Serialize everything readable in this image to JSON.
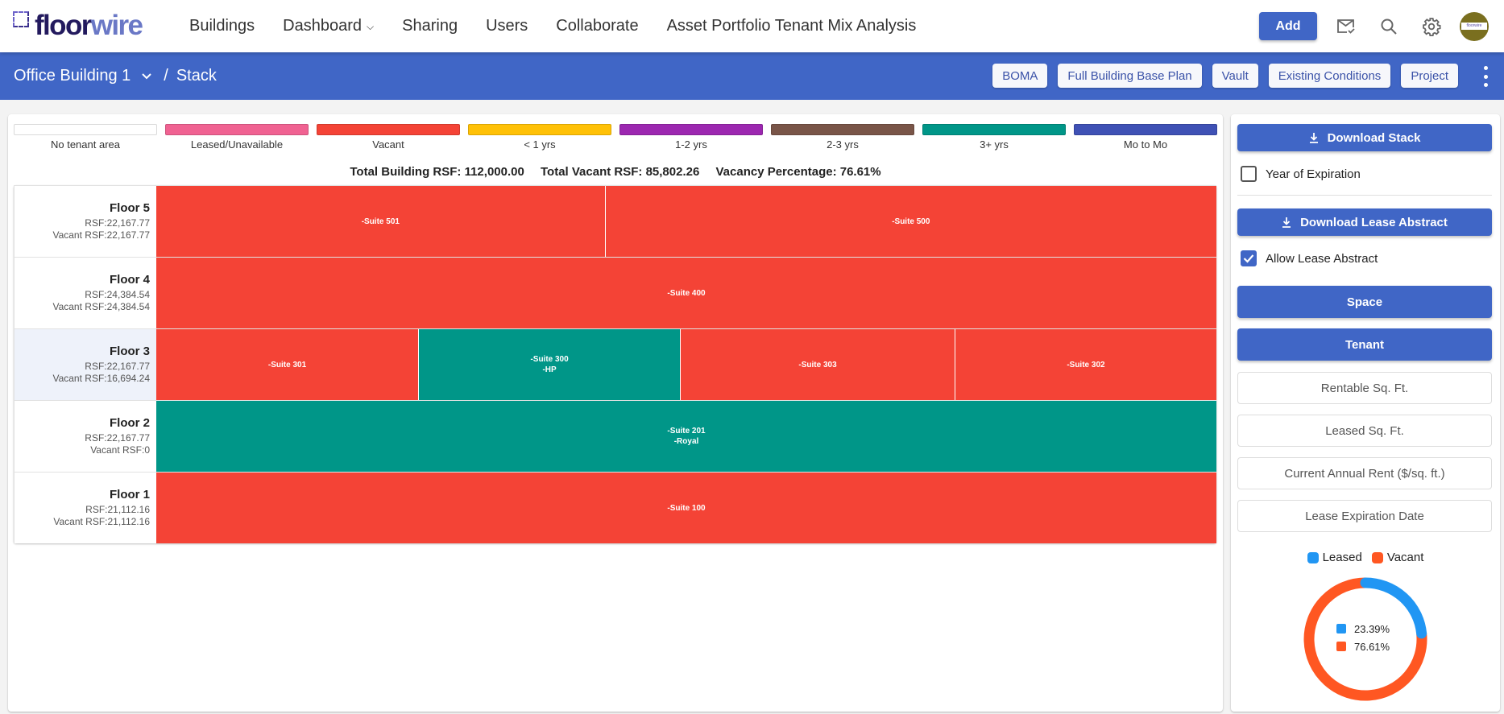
{
  "topnav": {
    "logo": {
      "part1": "floor",
      "part2": "wire"
    },
    "items": [
      {
        "label": "Buildings"
      },
      {
        "label": "Dashboard",
        "has_dropdown": true
      },
      {
        "label": "Sharing"
      },
      {
        "label": "Users"
      },
      {
        "label": "Collaborate"
      },
      {
        "label": "Asset Portfolio Tenant Mix Analysis"
      }
    ],
    "add_label": "Add",
    "icons": [
      "mail-check-icon",
      "search-icon",
      "gear-icon"
    ],
    "avatar_text": "floorwire"
  },
  "subheader": {
    "building": "Office Building 1",
    "separator": "/",
    "page": "Stack",
    "buttons": [
      {
        "label": "BOMA"
      },
      {
        "label": "Full Building Base Plan"
      },
      {
        "label": "Vault"
      },
      {
        "label": "Existing Conditions"
      },
      {
        "label": "Project"
      }
    ]
  },
  "colors": {
    "primary": "#4066c6",
    "vacant": "#f44336",
    "three_plus": "#009688",
    "donut_leased": "#2196f3",
    "donut_vacant": "#ff5722"
  },
  "legend": [
    {
      "label": "No tenant area",
      "color": "#ffffff"
    },
    {
      "label": "Leased/Unavailable",
      "color": "#f06292"
    },
    {
      "label": "Vacant",
      "color": "#f44336"
    },
    {
      "label": "< 1 yrs",
      "color": "#ffc107"
    },
    {
      "label": "1-2 yrs",
      "color": "#9c27b0"
    },
    {
      "label": "2-3 yrs",
      "color": "#795548"
    },
    {
      "label": "3+ yrs",
      "color": "#009688"
    },
    {
      "label": "Mo to Mo",
      "color": "#3f51b5"
    }
  ],
  "totals": {
    "total_building": "Total Building RSF: 112,000.00",
    "total_vacant": "Total Vacant RSF: 85,802.26",
    "vacancy": "Vacancy Percentage: 76.61%"
  },
  "floors": [
    {
      "name": "Floor 5",
      "rsf": "RSF:22,167.77",
      "vacant": "Vacant RSF:22,167.77",
      "highlight": false,
      "suites": [
        {
          "lines": [
            "-Suite 501"
          ],
          "status": "Vacant",
          "share": 0.423
        },
        {
          "lines": [
            "-Suite 500"
          ],
          "status": "Vacant",
          "share": 0.577
        }
      ]
    },
    {
      "name": "Floor 4",
      "rsf": "RSF:24,384.54",
      "vacant": "Vacant RSF:24,384.54",
      "highlight": false,
      "suites": [
        {
          "lines": [
            "-Suite 400"
          ],
          "status": "Vacant",
          "share": 1.0
        }
      ]
    },
    {
      "name": "Floor 3",
      "rsf": "RSF:22,167.77",
      "vacant": "Vacant RSF:16,694.24",
      "highlight": true,
      "suites": [
        {
          "lines": [
            "-Suite 301"
          ],
          "status": "Vacant",
          "share": 0.247
        },
        {
          "lines": [
            "-Suite 300",
            "-HP"
          ],
          "status": "3+ yrs",
          "share": 0.247
        },
        {
          "lines": [
            "-Suite 303"
          ],
          "status": "Vacant",
          "share": 0.259
        },
        {
          "lines": [
            "-Suite 302"
          ],
          "status": "Vacant",
          "share": 0.247
        }
      ]
    },
    {
      "name": "Floor 2",
      "rsf": "RSF:22,167.77",
      "vacant": "Vacant RSF:0",
      "highlight": false,
      "suites": [
        {
          "lines": [
            "-Suite 201",
            "-Royal"
          ],
          "status": "3+ yrs",
          "share": 1.0
        }
      ]
    },
    {
      "name": "Floor 1",
      "rsf": "RSF:21,112.16",
      "vacant": "Vacant RSF:21,112.16",
      "highlight": false,
      "suites": [
        {
          "lines": [
            "-Suite 100"
          ],
          "status": "Vacant",
          "share": 1.0
        }
      ]
    }
  ],
  "side": {
    "download_stack": "Download Stack",
    "year_of_expiration": {
      "label": "Year of Expiration",
      "checked": false
    },
    "download_lease_abstract": "Download Lease Abstract",
    "allow_lease_abstract": {
      "label": "Allow Lease Abstract",
      "checked": true
    },
    "space": "Space",
    "tenant": "Tenant",
    "fields": [
      "Rentable Sq. Ft.",
      "Leased Sq. Ft.",
      "Current Annual Rent ($/sq. ft.)",
      "Lease Expiration Date"
    ]
  },
  "chart_data": {
    "type": "pie",
    "variant": "donut",
    "categories": [
      "Leased",
      "Vacant"
    ],
    "values": [
      23.39,
      76.61
    ],
    "labels": [
      "23.39%",
      "76.61%"
    ],
    "colors": [
      "#2196f3",
      "#ff5722"
    ],
    "legend_position": "top"
  }
}
